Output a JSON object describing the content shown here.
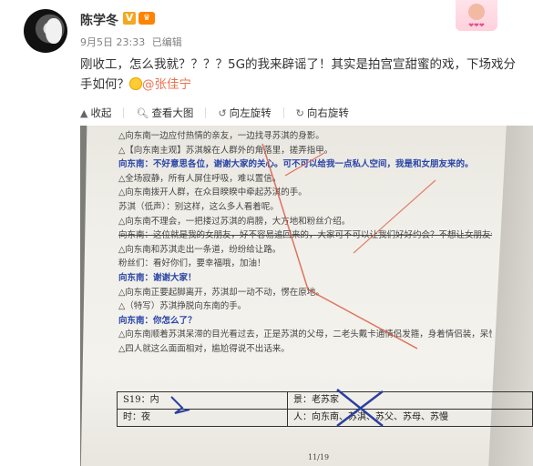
{
  "post": {
    "username": "陈学冬",
    "vip_badge": "V",
    "level_badge": "♛",
    "meta": {
      "date": "9月5日 23:33",
      "edited": "已编辑"
    },
    "sticker_text": "❤❤❤",
    "text_main": "刚收工，怎么我就？？？？5G的我来辟谣了！其实是拍宫宣甜蜜的戏，下场戏分手如何？",
    "mention": "@张佳宁"
  },
  "toolbar": {
    "collapse": "收起",
    "view_large": "查看大图",
    "rotate_left": "向左旋转",
    "rotate_right": "向右旋转",
    "icons": [
      "collapse-icon",
      "magnify-icon",
      "rotate-left-icon",
      "rotate-right-icon"
    ]
  },
  "script_page": {
    "lines": [
      "△向东南一边应付热情的亲友，一边找寻苏淇的身影。",
      "△【向东南主观】苏淇躲在人群外的角落里，搓弄指甲。",
      "向东南：不好意思各位，谢谢大家的关心。可不可以给我一点私人空间，我是和女朋友来的。",
      "△全场寂静，所有人屏住呼吸，难以置信。",
      "△向东南拨开人群，在众目睽睽中牵起苏淇的手。",
      "苏淇（低声）：别这样，这么多人看着呢。",
      "△向东南不理会，一把搂过苏淇的肩膀，大方地和粉丝介绍。",
      "向东南：这位就是我的女朋友，好不容易追回来的，大家可不可以让我们好好约会？不想让女朋友会生气的。",
      "△向东南和苏淇走出一条道，纷纷给让路。",
      "粉丝们：看好你们，要幸福哦，加油！",
      "向东南：谢谢大家！",
      "△向东南正要起脚离开，苏淇却一动不动，愣在原地。",
      "△（特写）苏淇挣脱向东南的手。",
      "向东南：你怎么了？",
      "△向东南顺着苏淇呆滞的目光看过去，正是苏淇的父母，二老头戴卡通情侣发箍，身着情侣装，呆愣地看着苏淇和向东南。",
      "△四人就这么面面相对，尴尬得说不出话来。"
    ],
    "table": {
      "scene": "S19：内",
      "time": "时：夜",
      "location": "景：老苏家",
      "people": "人：向东南、苏淇、苏父、苏母、苏慢"
    },
    "page_number": "11/19"
  }
}
